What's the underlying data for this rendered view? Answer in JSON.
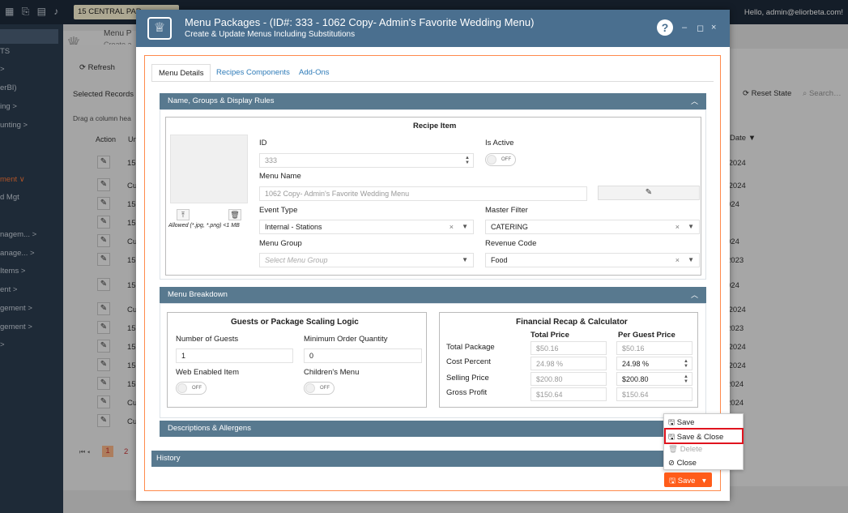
{
  "topbar": {
    "breadcrumb": "15 CENTRAL PAR",
    "greeting": "Hello, admin@eliorbeta.com!"
  },
  "sidebar": {
    "items": [
      "TS",
      ">",
      "erBI)",
      "ing  >",
      "unting  >",
      "ment  ∨",
      "d Mgt",
      "nagem...  >",
      "anage...  >",
      "Items  >",
      "ent  >",
      "gement  >",
      "gement  >",
      ">"
    ]
  },
  "bg": {
    "refresh": "Refresh",
    "selected_records": "Selected Records",
    "drag_hint": "Drag a column hea",
    "col_action": "Action",
    "col_un": "Un",
    "menu_label": "Menu P",
    "create_label": "Create a",
    "reset_state": "Reset State",
    "search": "Search",
    "date_header": "Date",
    "row_prefixes": [
      "15",
      "Cu",
      "15",
      "15",
      "Cu",
      "15",
      "15",
      "Cu",
      "15",
      "15",
      "15",
      "15",
      "Cu",
      "Cu"
    ],
    "dates": [
      "/2024",
      "/2024",
      "024",
      "024",
      "2023",
      "024",
      "/2024",
      "2023",
      "/2024",
      "/2024",
      "2024",
      "2024"
    ],
    "pager": [
      "1",
      "2"
    ]
  },
  "modal": {
    "title": "Menu Packages - (ID#: 333 - 1062 Copy- Admin's Favorite Wedding Menu)",
    "subtitle": "Create & Update Menus Including Substitutions",
    "help": "?",
    "tabs": [
      "Menu Details",
      "Recipes Components",
      "Add-Ons"
    ],
    "section1": {
      "title": "Name, Groups & Display Rules",
      "recipe_item": "Recipe Item",
      "allowed": "Allowed (*.jpg, *.png) <1 MB",
      "id_label": "ID",
      "id_value": "333",
      "active_label": "Is Active",
      "active_state": "OFF",
      "menu_name_label": "Menu Name",
      "menu_name_value": "1062 Copy- Admin's Favorite Wedding Menu",
      "event_type_label": "Event Type",
      "event_type_value": "Internal - Stations",
      "master_filter_label": "Master Filter",
      "master_filter_value": "CATERING",
      "menu_group_label": "Menu Group",
      "menu_group_placeholder": "Select Menu Group",
      "revenue_code_label": "Revenue Code",
      "revenue_code_value": "Food"
    },
    "section2": {
      "title": "Menu Breakdown",
      "guests_title": "Guests or Package Scaling Logic",
      "num_guests_label": "Number of Guests",
      "num_guests_value": "1",
      "min_order_label": "Minimum Order Quantity",
      "min_order_value": "0",
      "web_label": "Web Enabled Item",
      "web_state": "OFF",
      "children_label": "Children's Menu",
      "children_state": "OFF",
      "fin_title": "Financial Recap & Calculator",
      "col_total": "Total Price",
      "col_guest": "Per Guest Price",
      "rows": [
        {
          "label": "Total Package",
          "total": "$50.16",
          "guest": "$50.16"
        },
        {
          "label": "Cost Percent",
          "total": "24.98 %",
          "guest": "24.98 %"
        },
        {
          "label": "Selling Price",
          "total": "$200.80",
          "guest": "$200.80"
        },
        {
          "label": "Gross Profit",
          "total": "$150.64",
          "guest": "$150.64"
        }
      ]
    },
    "section3": {
      "title": "Descriptions & Allergens"
    },
    "history": "History",
    "save_menu": [
      "Save",
      "Save & Close",
      "Delete",
      "Close"
    ],
    "save_button": "Save"
  },
  "colors": {
    "header": "#4a6f8f",
    "panel": "#58798f",
    "accent": "#ff5c1a",
    "highlight": "#e0141e"
  }
}
